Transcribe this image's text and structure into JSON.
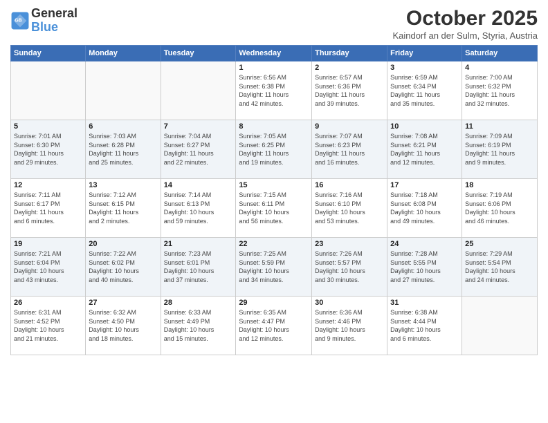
{
  "header": {
    "logo_line1": "General",
    "logo_line2": "Blue",
    "month": "October 2025",
    "location": "Kaindorf an der Sulm, Styria, Austria"
  },
  "weekdays": [
    "Sunday",
    "Monday",
    "Tuesday",
    "Wednesday",
    "Thursday",
    "Friday",
    "Saturday"
  ],
  "weeks": [
    [
      {
        "day": "",
        "info": ""
      },
      {
        "day": "",
        "info": ""
      },
      {
        "day": "",
        "info": ""
      },
      {
        "day": "1",
        "info": "Sunrise: 6:56 AM\nSunset: 6:38 PM\nDaylight: 11 hours\nand 42 minutes."
      },
      {
        "day": "2",
        "info": "Sunrise: 6:57 AM\nSunset: 6:36 PM\nDaylight: 11 hours\nand 39 minutes."
      },
      {
        "day": "3",
        "info": "Sunrise: 6:59 AM\nSunset: 6:34 PM\nDaylight: 11 hours\nand 35 minutes."
      },
      {
        "day": "4",
        "info": "Sunrise: 7:00 AM\nSunset: 6:32 PM\nDaylight: 11 hours\nand 32 minutes."
      }
    ],
    [
      {
        "day": "5",
        "info": "Sunrise: 7:01 AM\nSunset: 6:30 PM\nDaylight: 11 hours\nand 29 minutes."
      },
      {
        "day": "6",
        "info": "Sunrise: 7:03 AM\nSunset: 6:28 PM\nDaylight: 11 hours\nand 25 minutes."
      },
      {
        "day": "7",
        "info": "Sunrise: 7:04 AM\nSunset: 6:27 PM\nDaylight: 11 hours\nand 22 minutes."
      },
      {
        "day": "8",
        "info": "Sunrise: 7:05 AM\nSunset: 6:25 PM\nDaylight: 11 hours\nand 19 minutes."
      },
      {
        "day": "9",
        "info": "Sunrise: 7:07 AM\nSunset: 6:23 PM\nDaylight: 11 hours\nand 16 minutes."
      },
      {
        "day": "10",
        "info": "Sunrise: 7:08 AM\nSunset: 6:21 PM\nDaylight: 11 hours\nand 12 minutes."
      },
      {
        "day": "11",
        "info": "Sunrise: 7:09 AM\nSunset: 6:19 PM\nDaylight: 11 hours\nand 9 minutes."
      }
    ],
    [
      {
        "day": "12",
        "info": "Sunrise: 7:11 AM\nSunset: 6:17 PM\nDaylight: 11 hours\nand 6 minutes."
      },
      {
        "day": "13",
        "info": "Sunrise: 7:12 AM\nSunset: 6:15 PM\nDaylight: 11 hours\nand 2 minutes."
      },
      {
        "day": "14",
        "info": "Sunrise: 7:14 AM\nSunset: 6:13 PM\nDaylight: 10 hours\nand 59 minutes."
      },
      {
        "day": "15",
        "info": "Sunrise: 7:15 AM\nSunset: 6:11 PM\nDaylight: 10 hours\nand 56 minutes."
      },
      {
        "day": "16",
        "info": "Sunrise: 7:16 AM\nSunset: 6:10 PM\nDaylight: 10 hours\nand 53 minutes."
      },
      {
        "day": "17",
        "info": "Sunrise: 7:18 AM\nSunset: 6:08 PM\nDaylight: 10 hours\nand 49 minutes."
      },
      {
        "day": "18",
        "info": "Sunrise: 7:19 AM\nSunset: 6:06 PM\nDaylight: 10 hours\nand 46 minutes."
      }
    ],
    [
      {
        "day": "19",
        "info": "Sunrise: 7:21 AM\nSunset: 6:04 PM\nDaylight: 10 hours\nand 43 minutes."
      },
      {
        "day": "20",
        "info": "Sunrise: 7:22 AM\nSunset: 6:02 PM\nDaylight: 10 hours\nand 40 minutes."
      },
      {
        "day": "21",
        "info": "Sunrise: 7:23 AM\nSunset: 6:01 PM\nDaylight: 10 hours\nand 37 minutes."
      },
      {
        "day": "22",
        "info": "Sunrise: 7:25 AM\nSunset: 5:59 PM\nDaylight: 10 hours\nand 34 minutes."
      },
      {
        "day": "23",
        "info": "Sunrise: 7:26 AM\nSunset: 5:57 PM\nDaylight: 10 hours\nand 30 minutes."
      },
      {
        "day": "24",
        "info": "Sunrise: 7:28 AM\nSunset: 5:55 PM\nDaylight: 10 hours\nand 27 minutes."
      },
      {
        "day": "25",
        "info": "Sunrise: 7:29 AM\nSunset: 5:54 PM\nDaylight: 10 hours\nand 24 minutes."
      }
    ],
    [
      {
        "day": "26",
        "info": "Sunrise: 6:31 AM\nSunset: 4:52 PM\nDaylight: 10 hours\nand 21 minutes."
      },
      {
        "day": "27",
        "info": "Sunrise: 6:32 AM\nSunset: 4:50 PM\nDaylight: 10 hours\nand 18 minutes."
      },
      {
        "day": "28",
        "info": "Sunrise: 6:33 AM\nSunset: 4:49 PM\nDaylight: 10 hours\nand 15 minutes."
      },
      {
        "day": "29",
        "info": "Sunrise: 6:35 AM\nSunset: 4:47 PM\nDaylight: 10 hours\nand 12 minutes."
      },
      {
        "day": "30",
        "info": "Sunrise: 6:36 AM\nSunset: 4:46 PM\nDaylight: 10 hours\nand 9 minutes."
      },
      {
        "day": "31",
        "info": "Sunrise: 6:38 AM\nSunset: 4:44 PM\nDaylight: 10 hours\nand 6 minutes."
      },
      {
        "day": "",
        "info": ""
      }
    ]
  ]
}
